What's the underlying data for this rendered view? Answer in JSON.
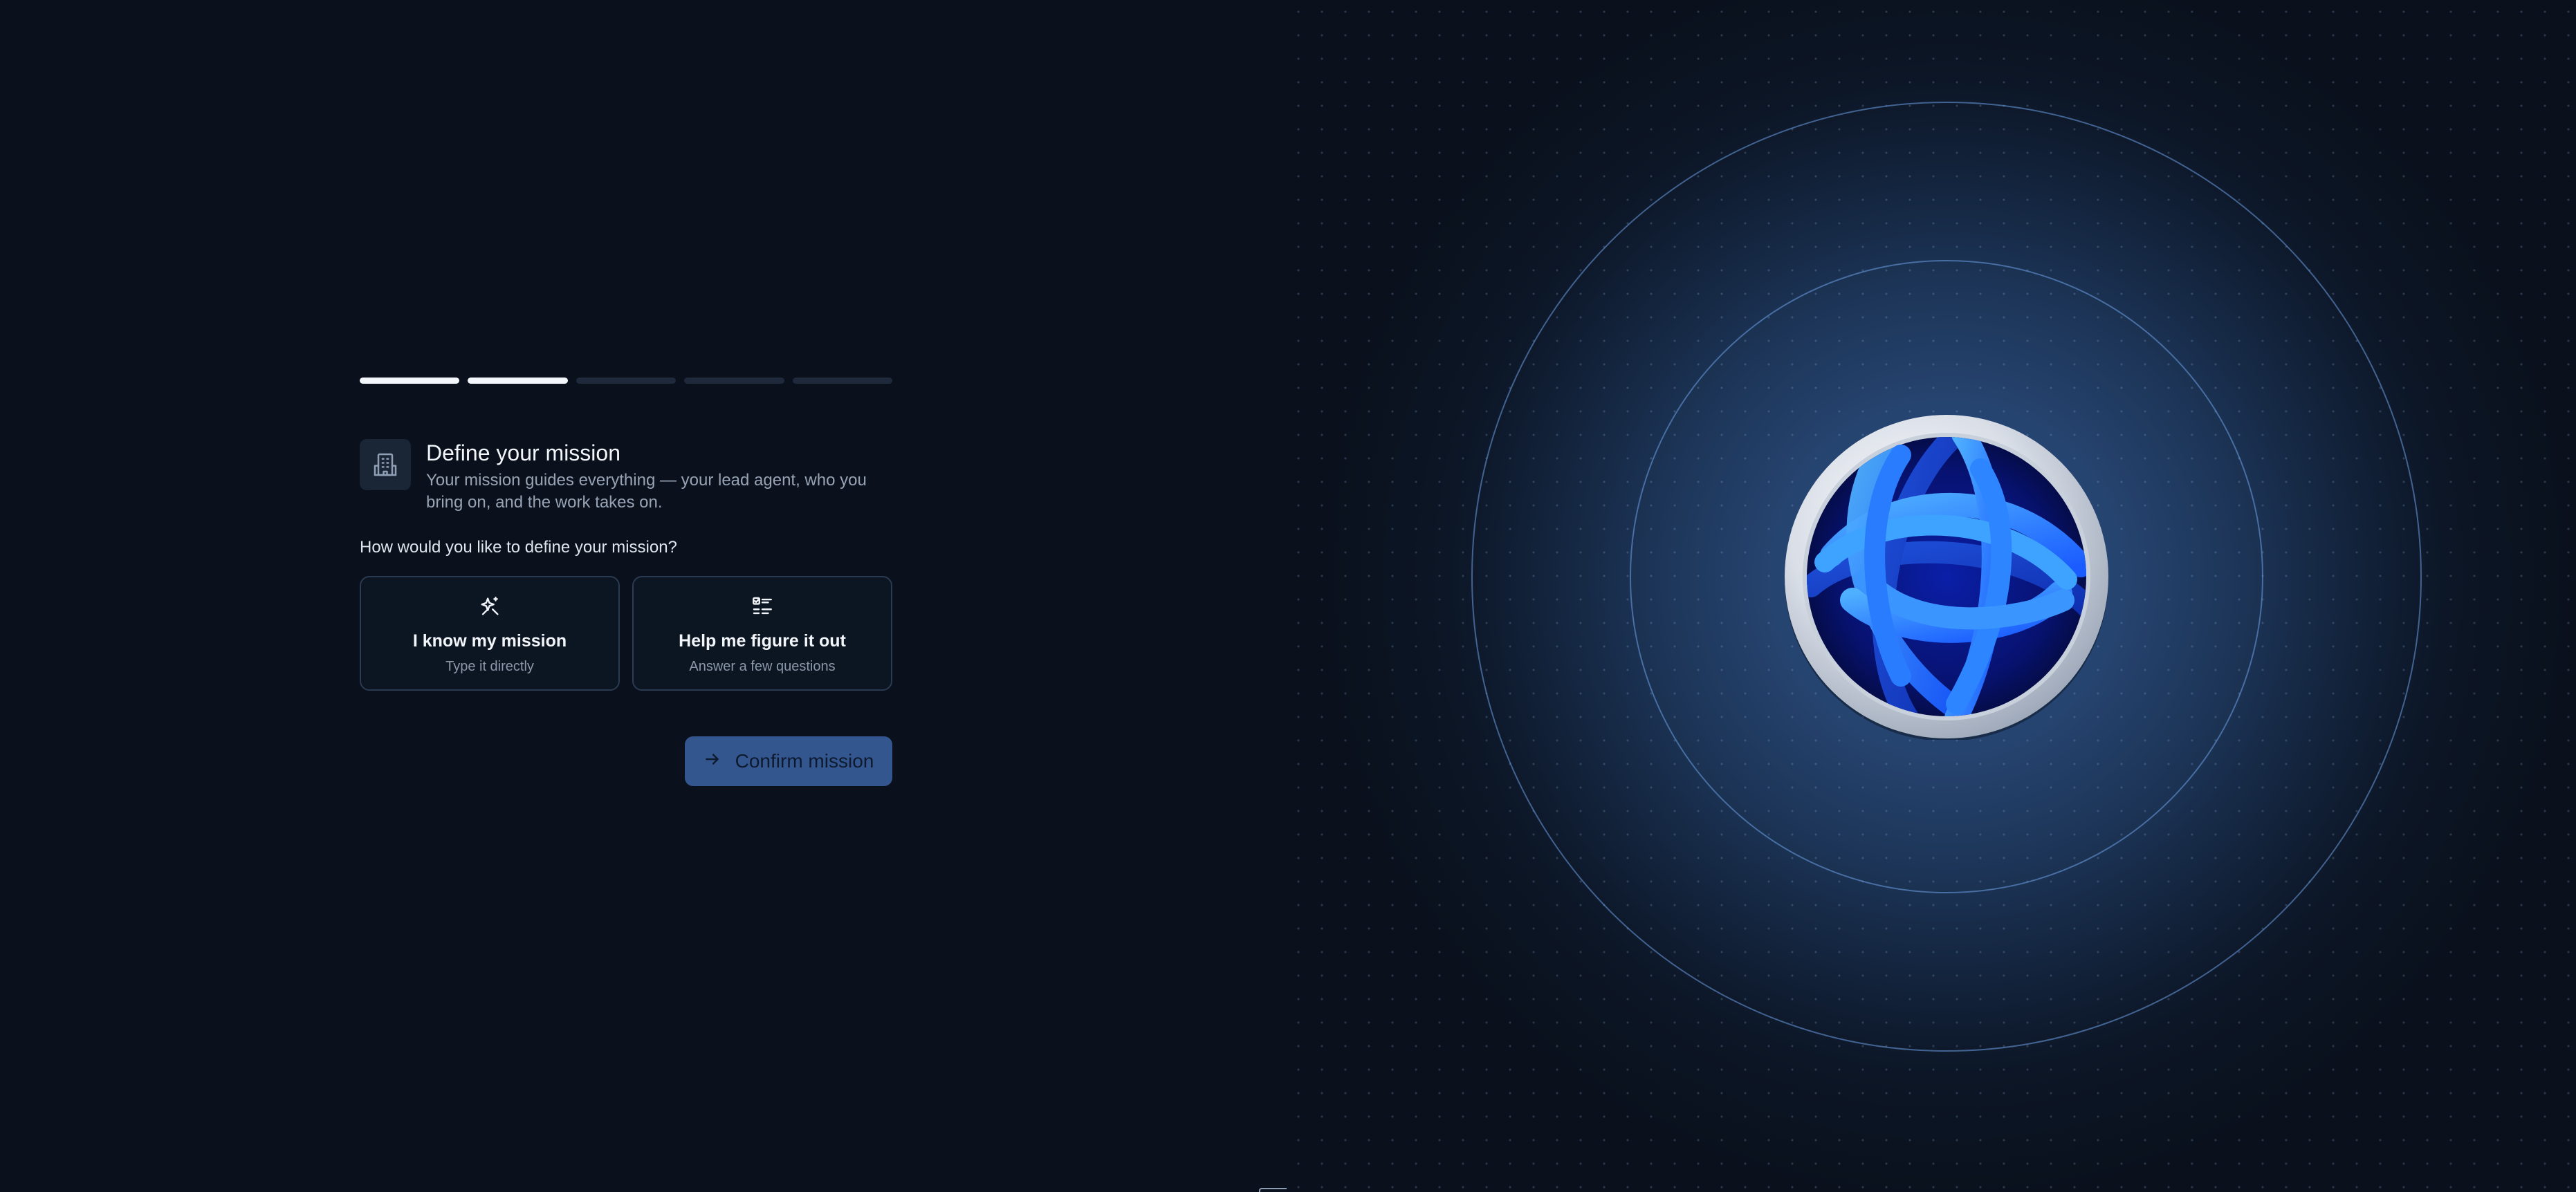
{
  "progress": {
    "total_steps": 5,
    "completed_steps": 2
  },
  "header": {
    "icon": "building-icon",
    "title": "Define your mission",
    "subtitle": "Your mission guides everything — your lead agent, who you bring on, and the work takes on."
  },
  "question": "How would you like to define your mission?",
  "options": [
    {
      "icon": "sparkle-edit-icon",
      "title": "I know my mission",
      "subtitle": "Type it directly"
    },
    {
      "icon": "checklist-icon",
      "title": "Help me figure it out",
      "subtitle": "Answer a few questions"
    }
  ],
  "confirm": {
    "icon": "arrow-right-icon",
    "label": "Confirm mission"
  },
  "colors": {
    "background": "#0a111d",
    "accent": "#34568f",
    "logo_blue": "#1f6fff"
  }
}
